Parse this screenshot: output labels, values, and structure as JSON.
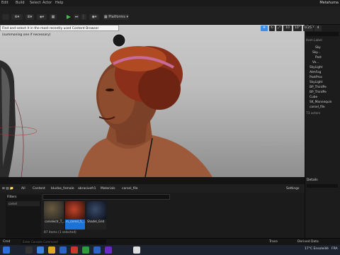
{
  "menu": {
    "items": [
      "Edit",
      "Window",
      "Tools",
      "Build",
      "Select",
      "Actor",
      "Help"
    ],
    "window_title": "Metahuma"
  },
  "toolbar": {
    "platforms_label": "Platforms"
  },
  "viewport": {
    "tooltip": "Find and select it in the most recently used Content Browser (summoning one if necessary)",
    "controls": [
      "10",
      "10°",
      "0.25",
      "4"
    ],
    "accent": "#3c8ee6"
  },
  "outliner": {
    "title": "Outliner",
    "column_header": "Item Label",
    "rows": [
      "Sky",
      "Sky...",
      "Post",
      "Vo...",
      "SkyLight",
      "AtmFog",
      "PostProc",
      "SkyLight",
      "BP_ThirdPe",
      "BP_ThirdPe",
      "Cube",
      "SK_Mannequin",
      "carsel_file"
    ],
    "actors_count": "73 actors"
  },
  "details": {
    "title": "Details"
  },
  "content_browser": {
    "breadcrumbs": [
      "All",
      "Content",
      "bludas_female",
      "abrasivefr1",
      "Materials",
      "carsel_file"
    ],
    "settings_label": "Settings",
    "search_placeholder": "",
    "filters_label": "Filters",
    "filter_item": "carsel",
    "assets": [
      {
        "name": "carselectr_T_...",
        "color": "#3b2d1f"
      },
      {
        "name": "m_carsel_5_...",
        "color": "#7a1e14",
        "selected": true
      },
      {
        "name": "Shadel_Grid",
        "color": "#1e2a3c"
      }
    ],
    "item_count": "87 items (1 selected)"
  },
  "statusbar": {
    "cmd_label": "Cmd",
    "cmd_placeholder": "Enter Console Command",
    "trace_label": "Trace",
    "derived_data": "Derived Data",
    "source_control": "Source Control"
  },
  "taskbar": {
    "weather": "17°C Ensoleillé",
    "language": "FRA",
    "time": "",
    "date": ""
  }
}
